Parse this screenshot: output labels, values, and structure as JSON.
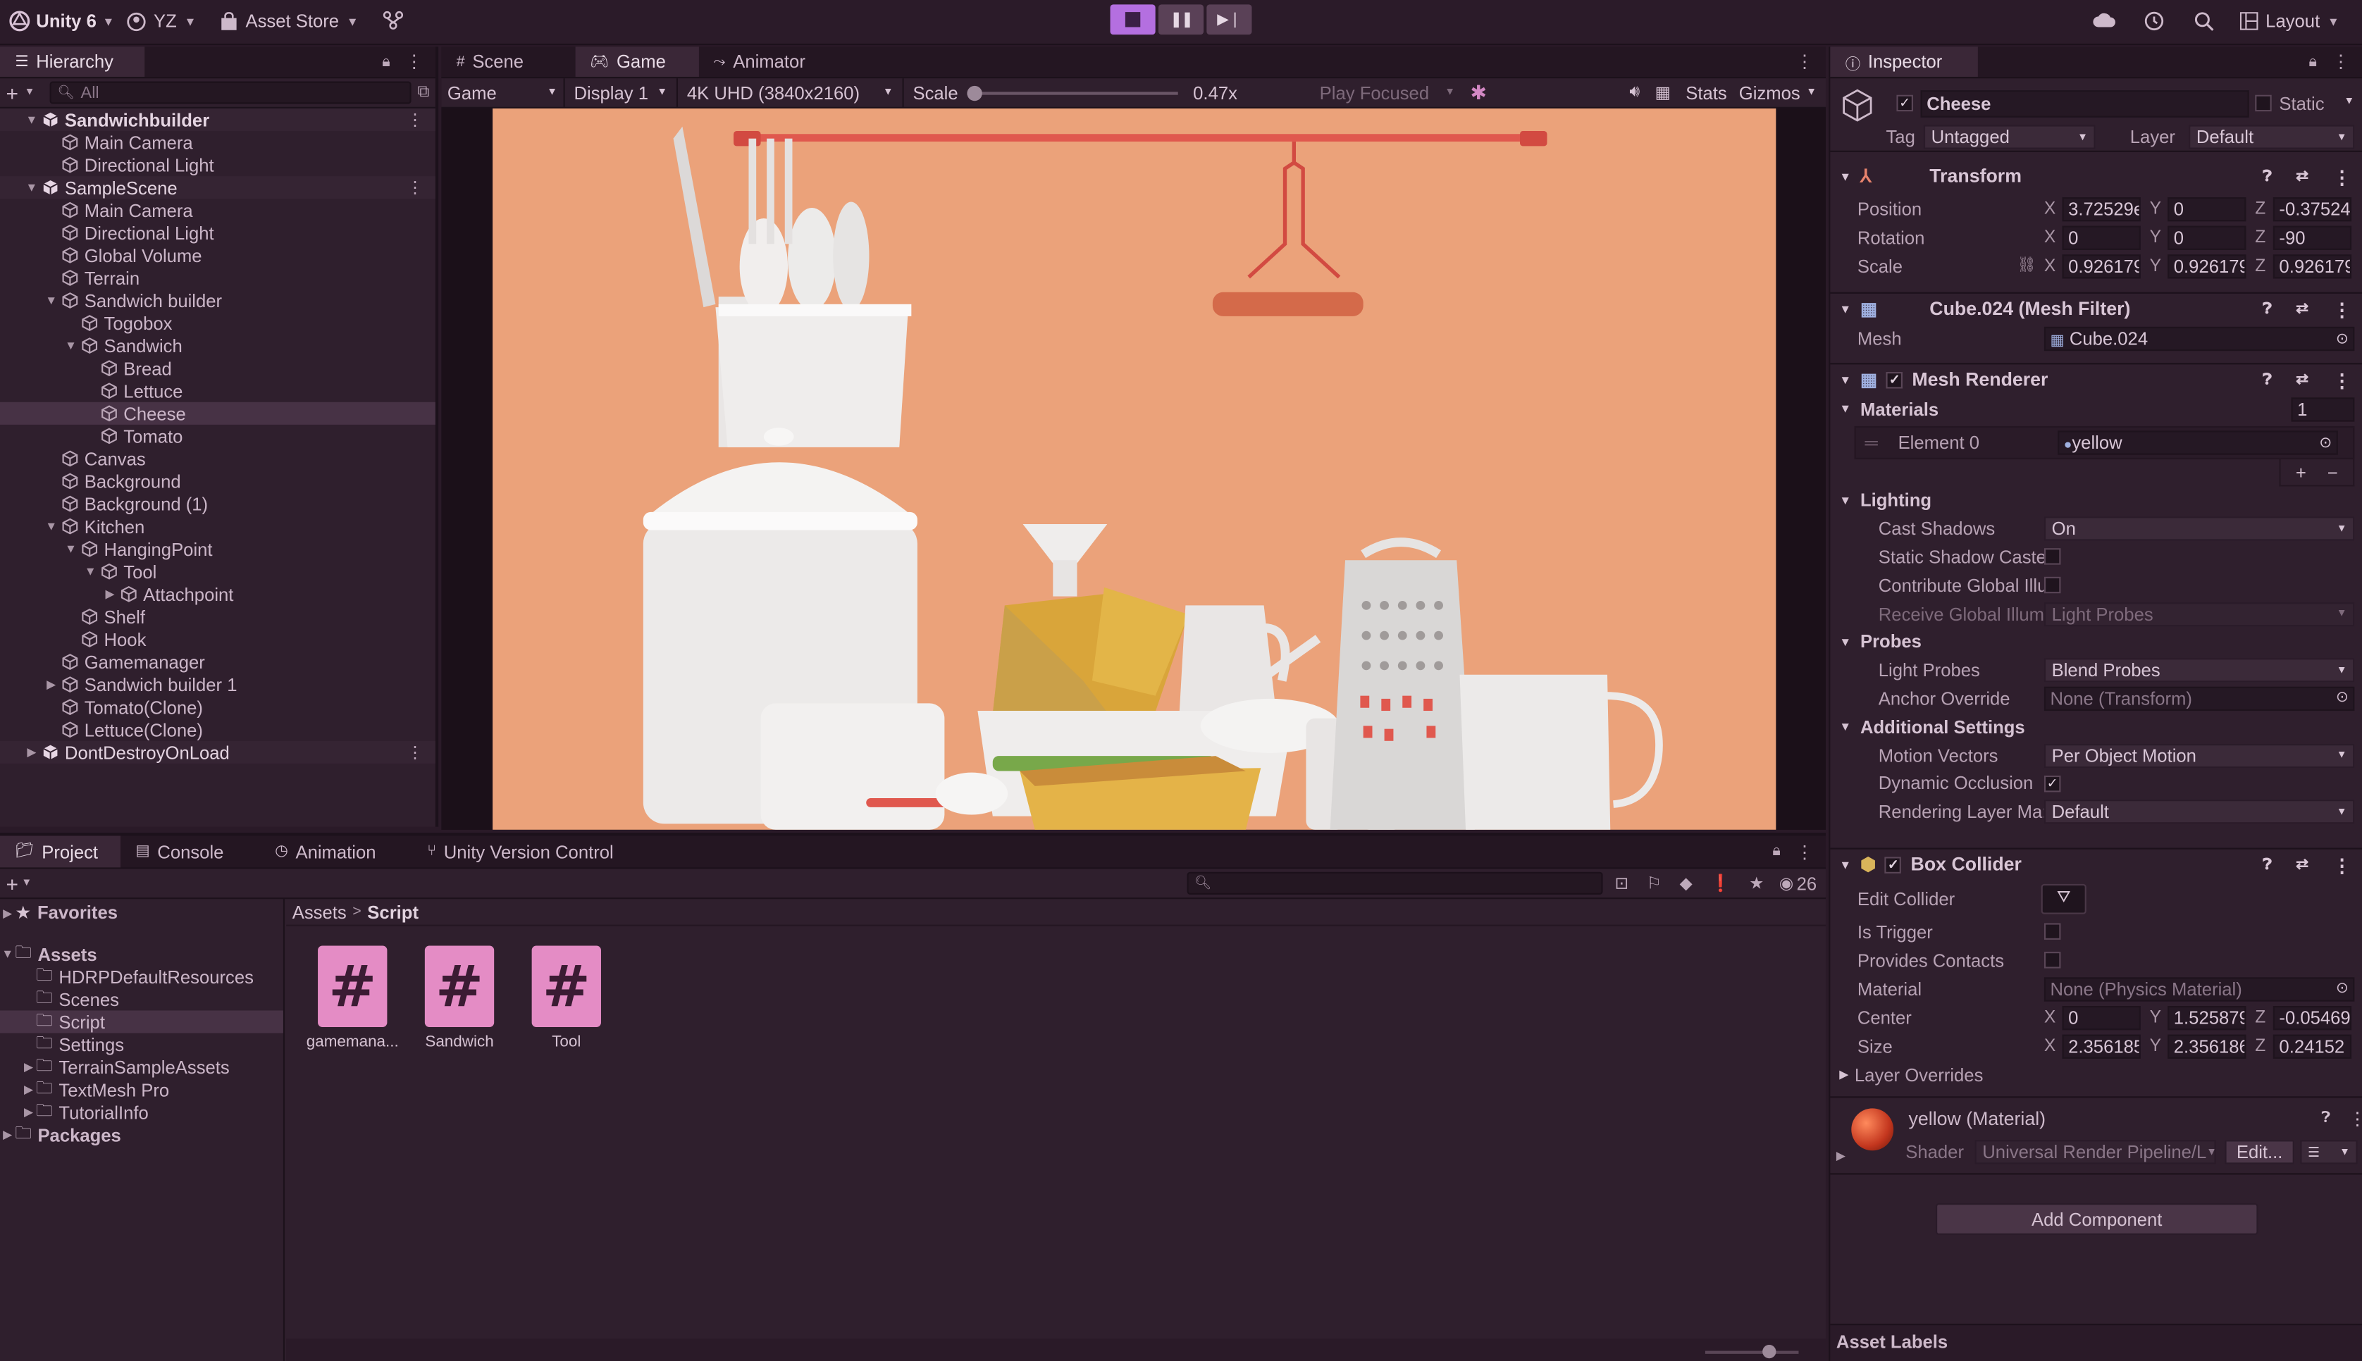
{
  "top": {
    "app": "Unity 6",
    "account": "YZ",
    "asset_store": "Asset Store",
    "layout": "Layout"
  },
  "hierarchy": {
    "tab": "Hierarchy",
    "search_placeholder": "All",
    "items": [
      {
        "label": "Sandwichbuilder",
        "depth": 0,
        "kind": "scene",
        "arrow": "open",
        "bold": true,
        "dots": true
      },
      {
        "label": "Main Camera",
        "depth": 1,
        "kind": "obj"
      },
      {
        "label": "Directional Light",
        "depth": 1,
        "kind": "obj"
      },
      {
        "label": "SampleScene",
        "depth": 0,
        "kind": "scene",
        "arrow": "open",
        "bold": false,
        "dots": true
      },
      {
        "label": "Main Camera",
        "depth": 1,
        "kind": "obj"
      },
      {
        "label": "Directional Light",
        "depth": 1,
        "kind": "obj"
      },
      {
        "label": "Global Volume",
        "depth": 1,
        "kind": "obj"
      },
      {
        "label": "Terrain",
        "depth": 1,
        "kind": "obj"
      },
      {
        "label": "Sandwich builder",
        "depth": 1,
        "kind": "obj",
        "arrow": "open"
      },
      {
        "label": "Togobox",
        "depth": 2,
        "kind": "obj"
      },
      {
        "label": "Sandwich",
        "depth": 2,
        "kind": "obj",
        "arrow": "open"
      },
      {
        "label": "Bread",
        "depth": 3,
        "kind": "obj"
      },
      {
        "label": "Lettuce",
        "depth": 3,
        "kind": "obj"
      },
      {
        "label": "Cheese",
        "depth": 3,
        "kind": "obj",
        "selected": true
      },
      {
        "label": "Tomato",
        "depth": 3,
        "kind": "obj"
      },
      {
        "label": "Canvas",
        "depth": 1,
        "kind": "obj"
      },
      {
        "label": "Background",
        "depth": 1,
        "kind": "obj"
      },
      {
        "label": "Background (1)",
        "depth": 1,
        "kind": "obj"
      },
      {
        "label": "Kitchen",
        "depth": 1,
        "kind": "obj",
        "arrow": "open"
      },
      {
        "label": "HangingPoint",
        "depth": 2,
        "kind": "obj",
        "arrow": "open"
      },
      {
        "label": "Tool",
        "depth": 3,
        "kind": "obj",
        "arrow": "open"
      },
      {
        "label": "Attachpoint",
        "depth": 4,
        "kind": "obj",
        "arrow": "closed"
      },
      {
        "label": "Shelf",
        "depth": 2,
        "kind": "obj"
      },
      {
        "label": "Hook",
        "depth": 2,
        "kind": "obj"
      },
      {
        "label": "Gamemanager",
        "depth": 1,
        "kind": "obj"
      },
      {
        "label": "Sandwich builder 1",
        "depth": 1,
        "kind": "obj",
        "arrow": "closed"
      },
      {
        "label": "Tomato(Clone)",
        "depth": 1,
        "kind": "obj"
      },
      {
        "label": "Lettuce(Clone)",
        "depth": 1,
        "kind": "obj"
      },
      {
        "label": "DontDestroyOnLoad",
        "depth": 0,
        "kind": "scene",
        "arrow": "closed",
        "dots": true
      }
    ]
  },
  "center_tabs": {
    "scene": "Scene",
    "game": "Game",
    "animator": "Animator"
  },
  "game_toolbar": {
    "view": "Game",
    "display": "Display 1",
    "resolution": "4K UHD (3840x2160)",
    "scale_label": "Scale",
    "scale_value": "0.47x",
    "play_focused": "Play Focused",
    "stats": "Stats",
    "gizmos": "Gizmos"
  },
  "bottom_tabs": {
    "project": "Project",
    "console": "Console",
    "animation": "Animation",
    "uvc": "Unity Version Control"
  },
  "project": {
    "count": "26",
    "favorites": "Favorites",
    "assets": "Assets",
    "folders": [
      "HDRPDefaultResources",
      "Scenes",
      "Script",
      "Settings",
      "TerrainSampleAssets",
      "TextMesh Pro",
      "TutorialInfo"
    ],
    "packages": "Packages",
    "breadcrumb_root": "Assets",
    "breadcrumb_current": "Script",
    "files": [
      "gamemana...",
      "Sandwich",
      "Tool"
    ],
    "file_glyph": "#"
  },
  "inspector": {
    "tab": "Inspector",
    "object_name": "Cheese",
    "static_label": "Static",
    "tag_label": "Tag",
    "tag_value": "Untagged",
    "layer_label": "Layer",
    "layer_value": "Default",
    "transform": {
      "title": "Transform",
      "position_label": "Position",
      "rotation_label": "Rotation",
      "scale_label": "Scale",
      "position": {
        "x": "3.72529e",
        "y": "0",
        "z": "-0.37524"
      },
      "rotation": {
        "x": "0",
        "y": "0",
        "z": "-90"
      },
      "scale": {
        "x": "0.926179",
        "y": "0.926179",
        "z": "0.926179"
      }
    },
    "mesh_filter": {
      "title": "Cube.024 (Mesh Filter)",
      "mesh_label": "Mesh",
      "mesh_value": "Cube.024"
    },
    "mesh_renderer": {
      "title": "Mesh Renderer",
      "materials_label": "Materials",
      "materials_count": "1",
      "element_label": "Element 0",
      "element_value": "yellow",
      "lighting_label": "Lighting",
      "cast_shadows_label": "Cast Shadows",
      "cast_shadows_value": "On",
      "static_shadow_label": "Static Shadow Caste",
      "contribute_gi_label": "Contribute Global Illu",
      "receive_gi_label": "Receive Global Illumi",
      "receive_gi_value": "Light Probes",
      "probes_label": "Probes",
      "light_probes_label": "Light Probes",
      "light_probes_value": "Blend Probes",
      "anchor_label": "Anchor Override",
      "anchor_value": "None (Transform)",
      "additional_label": "Additional Settings",
      "motion_vectors_label": "Motion Vectors",
      "motion_vectors_value": "Per Object Motion",
      "dynamic_occlusion_label": "Dynamic Occlusion",
      "rendering_layer_label": "Rendering Layer Ma:",
      "rendering_layer_value": "Default"
    },
    "box_collider": {
      "title": "Box Collider",
      "edit_label": "Edit Collider",
      "trigger_label": "Is Trigger",
      "contacts_label": "Provides Contacts",
      "material_label": "Material",
      "material_value": "None (Physics Material)",
      "center_label": "Center",
      "size_label": "Size",
      "center": {
        "x": "0",
        "y": "1.525879",
        "z": "-0.05469"
      },
      "size": {
        "x": "2.356185",
        "y": "2.356186",
        "z": "0.24152"
      },
      "layer_overrides": "Layer Overrides"
    },
    "material": {
      "title": "yellow (Material)",
      "shader_label": "Shader",
      "shader_value": "Universal Render Pipeline/L",
      "edit": "Edit..."
    },
    "add_component": "Add Component",
    "asset_labels": "Asset Labels"
  },
  "xyz": {
    "x": "X",
    "y": "Y",
    "z": "Z"
  },
  "colors": {
    "accent": "#e48cc5",
    "background": "#2a1a28",
    "game_bg": "#eba27a",
    "play_button": "#b46fe0"
  }
}
